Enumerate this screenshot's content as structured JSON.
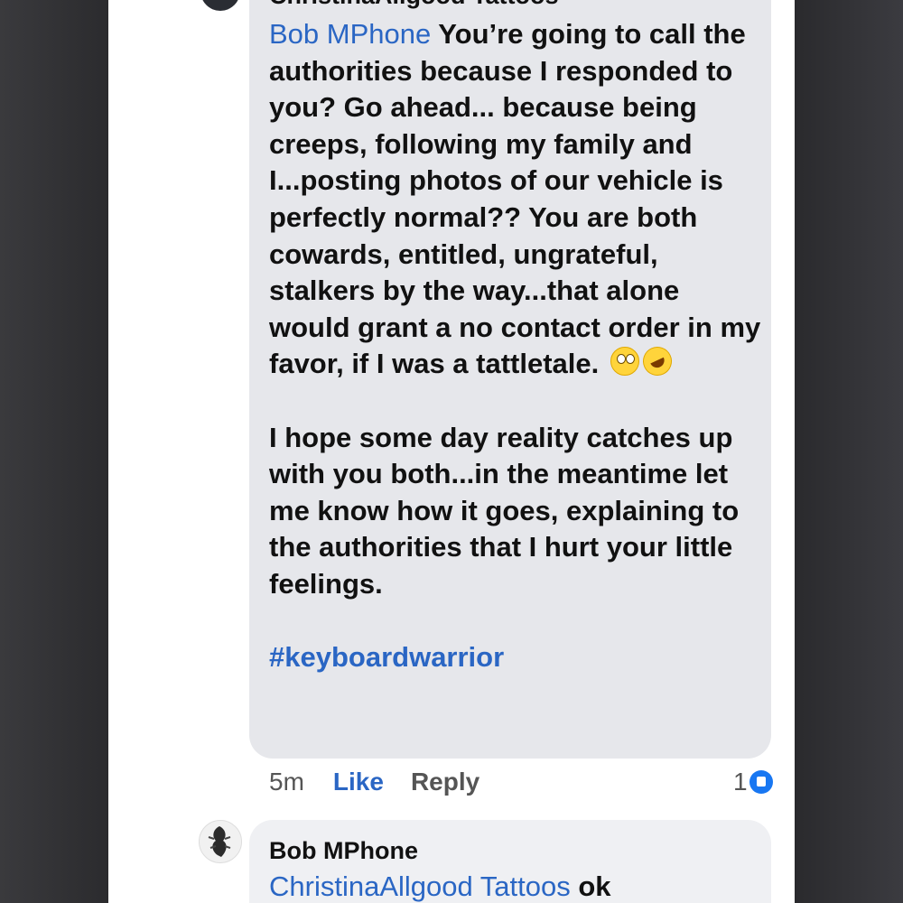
{
  "comment1": {
    "author": "ChristinaAllgood Tattoos",
    "mention": "Bob MPhone",
    "paragraph1_text": " You’re going to call the authorities because I responded to you? Go ahead... because being creeps, following my family and I...posting photos of our vehicle is perfectly normal?? You are both cowards, entitled, ungrateful, stalkers by the way...that alone would grant a no contact order in my favor, if I was a tattletale.",
    "emojis": [
      "face-with-rolling-eyes",
      "rolling-on-the-floor-laughing"
    ],
    "paragraph2": "I hope some day reality catches up with you both...in the meantime let me know how it goes, explaining to the authorities that I hurt your little feelings.",
    "hashtag": "#keyboardwarrior",
    "time": "5m",
    "like_label": "Like",
    "reply_label": "Reply",
    "reaction_count": "1",
    "reaction_icon": "like-icon"
  },
  "comment2": {
    "author": "Bob MPhone",
    "mention": "ChristinaAllgood Tattoos",
    "text": " ok"
  },
  "colors": {
    "link": "#2a66c4",
    "bubble": "#e6e7eb",
    "reaction": "#1877f2"
  }
}
